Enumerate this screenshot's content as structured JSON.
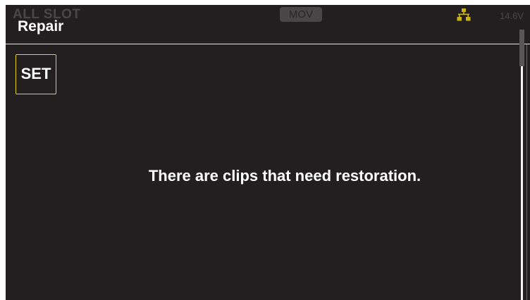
{
  "status_bar": {
    "slot_label": "ALL SLOT",
    "format": "MOV",
    "network_icon": "network-icon",
    "voltage": "14.6V"
  },
  "page": {
    "title": "Repair",
    "set_button_label": "SET",
    "message": "There are clips that need restoration."
  },
  "colors": {
    "background": "#231f20",
    "highlight": "#e8d21d",
    "text": "#ffffff",
    "dim_text": "#4a4647",
    "network_icon": "#c8b41a"
  }
}
